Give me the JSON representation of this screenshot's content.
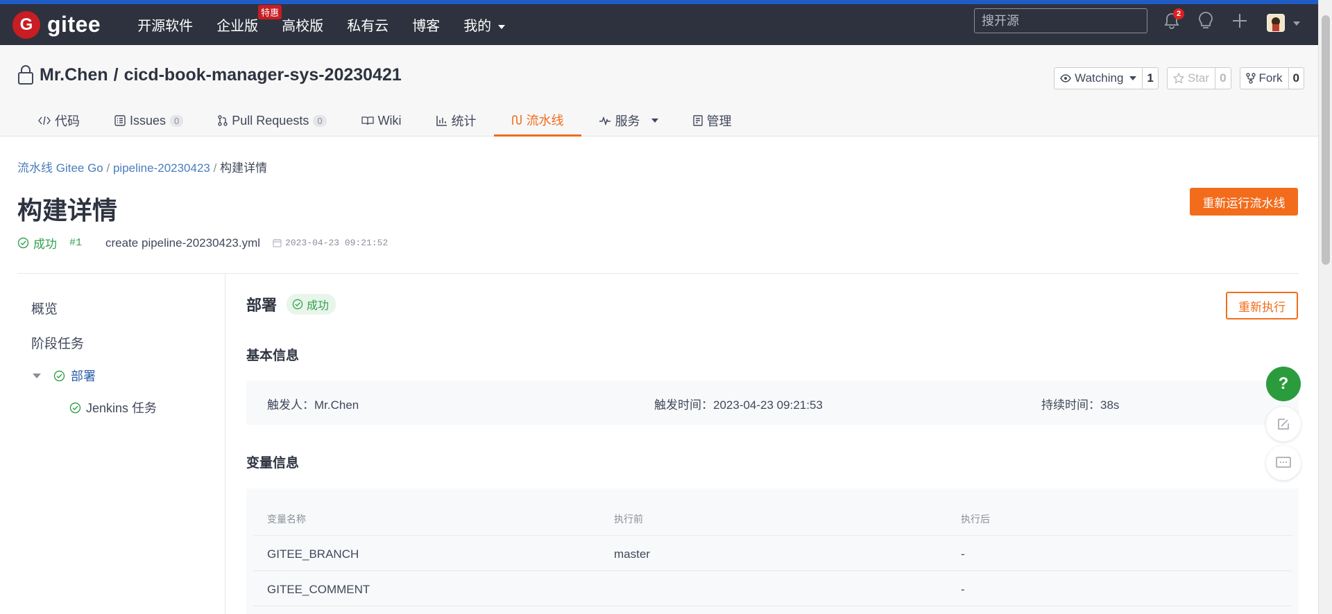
{
  "topnav": {
    "logo_text": "gitee",
    "items": [
      {
        "label": "开源软件"
      },
      {
        "label": "企业版",
        "badge": "特惠"
      },
      {
        "label": "高校版"
      },
      {
        "label": "私有云"
      },
      {
        "label": "博客"
      },
      {
        "label": "我的"
      }
    ],
    "search_placeholder": "搜开源",
    "notification_count": "2"
  },
  "repo": {
    "owner": "Mr.Chen",
    "separator": "/",
    "name": "cicd-book-manager-sys-20230421",
    "watch_label": "Watching",
    "watch_count": "1",
    "star_label": "Star",
    "star_count": "0",
    "fork_label": "Fork",
    "fork_count": "0"
  },
  "tabs": [
    {
      "label": "代码",
      "icon": "code-icon"
    },
    {
      "label": "Issues",
      "count": "0",
      "icon": "issues-icon"
    },
    {
      "label": "Pull Requests",
      "count": "0",
      "icon": "pull-request-icon"
    },
    {
      "label": "Wiki",
      "icon": "wiki-icon"
    },
    {
      "label": "统计",
      "icon": "chart-icon"
    },
    {
      "label": "流水线",
      "icon": "pipeline-icon",
      "active": true
    },
    {
      "label": "服务",
      "icon": "pulse-icon"
    },
    {
      "label": "管理",
      "icon": "manage-icon"
    }
  ],
  "breadcrumb": {
    "root": "流水线 Gitee Go",
    "sep": "/",
    "pipeline": "pipeline-20230423",
    "current": "构建详情"
  },
  "page": {
    "title": "构建详情",
    "rerun_label": "重新运行流水线",
    "status": "成功",
    "run_number": "#1",
    "commit_message": "create pipeline-20230423.yml",
    "date": "2023-04-23 09:21:52"
  },
  "sidebar": {
    "overview": "概览",
    "stage_tasks": "阶段任务",
    "stage": "部署",
    "task": "Jenkins 任务"
  },
  "stage": {
    "title": "部署",
    "status": "成功",
    "reexec_label": "重新执行",
    "basic_info_title": "基本信息",
    "trigger_by": "触发人：Mr.Chen",
    "trigger_time": "触发时间：2023-04-23 09:21:53",
    "duration": "持续时间：38s",
    "var_info_title": "变量信息",
    "var_headers": [
      "变量名称",
      "执行前",
      "执行后"
    ],
    "vars": [
      {
        "name": "GITEE_BRANCH",
        "before": "master",
        "after": "-"
      },
      {
        "name": "GITEE_COMMENT",
        "before": "",
        "after": "-"
      }
    ]
  },
  "floating": {
    "help": "?"
  },
  "colors": {
    "brand": "#c71d23",
    "accent": "#f26c1c",
    "success": "#32a04c",
    "topnav_bg": "#2e323e"
  }
}
